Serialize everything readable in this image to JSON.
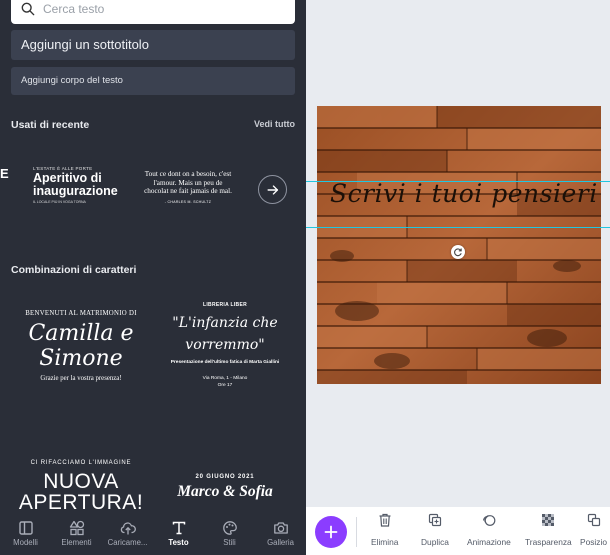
{
  "search": {
    "placeholder": "Cerca testo"
  },
  "buttons": {
    "subtitle": "Aggiungi un sottotitolo",
    "body": "Aggiungi corpo del testo"
  },
  "recent": {
    "title": "Usati di recente",
    "see_all": "Vedi tutto",
    "edge_letter": "E",
    "item1": {
      "kicker": "L'ESTATE È ALLE PORTE",
      "heading": "Aperitivo di inaugurazione",
      "small": "IL LOCALE PIÙ IN VOGA TORNA"
    },
    "item2": {
      "quote": "Tout ce dont on a besoin, c'est l'amour. Mais un peu de chocolat ne fait jamais de mal.",
      "author": "- CHARLES M. SCHULTZ"
    }
  },
  "combos": {
    "title": "Combinazioni di caratteri",
    "c1": {
      "top": "BENVENUTI AL MATRIMONIO DI",
      "name1": "Camilla e",
      "name2": "Simone",
      "bottom": "Grazie per la vostra presenza!"
    },
    "c2": {
      "top": "LIBRERIA LIBER",
      "script1": "\"L'infanzia che",
      "script2": "vorremmo\"",
      "desc": "Presentazione dell'ultimo fatica di Marta Giallini",
      "addr1": "Via Roma, 1 - Milano",
      "addr2": "Ore 17"
    },
    "c3": {
      "top": "CI RIFACCIAMO L'IMMAGINE",
      "line1": "NUOVA",
      "line2": "APERTURA!"
    },
    "c4": {
      "top": "20 GIUGNO 2021",
      "names": "Marco & Sofia"
    }
  },
  "nav": [
    {
      "label": "Modelli",
      "icon": "layout-icon"
    },
    {
      "label": "Elementi",
      "icon": "shapes-icon"
    },
    {
      "label": "Caricame...",
      "icon": "cloud-upload-icon"
    },
    {
      "label": "Testo",
      "icon": "text-icon",
      "active": true
    },
    {
      "label": "Stili",
      "icon": "palette-icon"
    },
    {
      "label": "Galleria",
      "icon": "camera-icon"
    }
  ],
  "canvas": {
    "text": "Scrivi i tuoi pensieri"
  },
  "toolbar": {
    "delete": "Elimina",
    "duplicate": "Duplica",
    "animation": "Animazione",
    "transparency": "Trasparenza",
    "position": "Posizio"
  },
  "colors": {
    "accent": "#8b3dff",
    "panel": "#2a2e38",
    "guide": "#21c6e0"
  }
}
